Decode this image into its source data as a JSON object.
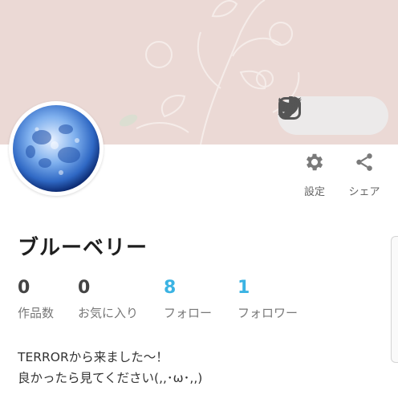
{
  "profile": {
    "name": "ブルーベリー",
    "bio": [
      "TERRORから来ました〜！",
      "良かったら見てください(,,･ω･,,)"
    ]
  },
  "actions": {
    "settings_label": "設定",
    "share_label": "シェア"
  },
  "social": {
    "icons": [
      "twitter-icon",
      "tiktok-icon",
      "instagram-icon"
    ]
  },
  "stats": [
    {
      "value": "0",
      "label": "作品数"
    },
    {
      "value": "0",
      "label": "お気に入り"
    },
    {
      "value": "8",
      "label": "フォロー"
    },
    {
      "value": "1",
      "label": "フォロワー"
    }
  ],
  "colors": {
    "accent": "#3bb3e3",
    "cover_bg": "#ebd9d5"
  }
}
